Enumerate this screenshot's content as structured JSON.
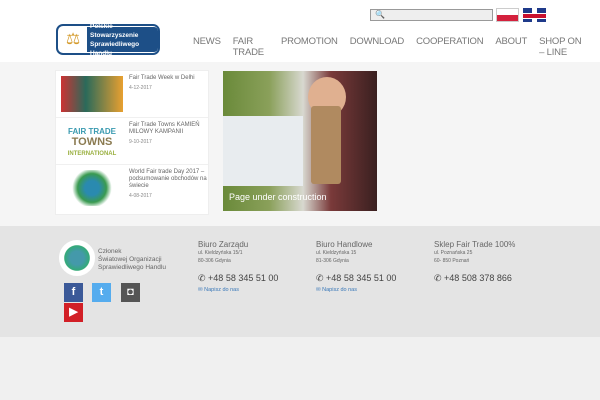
{
  "header": {
    "logo_line1": "Polskie Stowarzyszenie",
    "logo_line2": "Sprawiedliwego Handlu",
    "search_placeholder": "",
    "languages": [
      "PL",
      "EN"
    ],
    "nav": [
      "NEWS",
      "FAIR TRADE",
      "PROMOTION",
      "DOWNLOAD",
      "COOPERATION",
      "ABOUT",
      "SHOP ON – LINE"
    ]
  },
  "news": [
    {
      "title": "Fair Trade Week w Delhi",
      "date": "4-12-2017"
    },
    {
      "title": "Fair Trade Towns KAMIEŃ MILOWY KAMPANII",
      "date": "9-10-2017"
    },
    {
      "title": "World Fair trade Day 2017 – podsumowanie obchodów na świecie",
      "date": "4-08-2017"
    }
  ],
  "feature": {
    "caption": "Page under construction"
  },
  "footer": {
    "member": [
      "Członek",
      "Światowej Organizacji",
      "Sprawiedliwego Handlu"
    ],
    "social": [
      "facebook",
      "twitter",
      "instagram",
      "youtube"
    ],
    "offices": [
      {
        "name": "Biuro Zarządu",
        "street": "ul. Kieldzyńska 15/1",
        "city": "80-306 Gdynia",
        "phone": "+48 58 345 51 00",
        "mail": "Napisz do nas"
      },
      {
        "name": "Biuro Handlowe",
        "street": "ul. Kieldzyńska 15",
        "city": "81-306 Gdynia",
        "phone": "+48 58 345 51 00",
        "mail": "Napisz do nas"
      },
      {
        "name": "Sklep Fair Trade 100%",
        "street": "ul. Poznańska 25",
        "city": "60- 850 Poznań",
        "phone": "+48 508 378 866"
      }
    ]
  }
}
